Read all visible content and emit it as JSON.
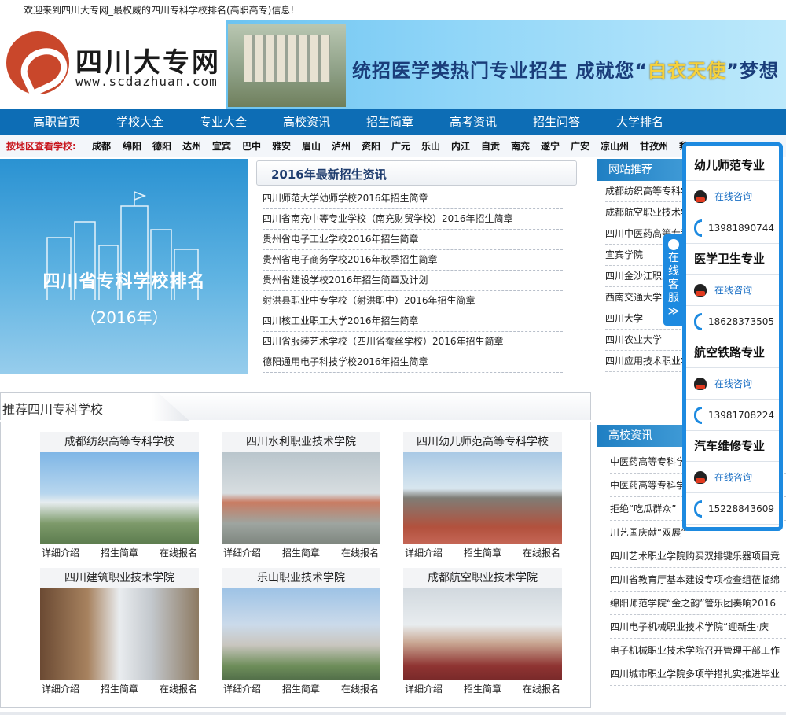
{
  "topbar": {
    "text": "欢迎来到四川大专网_最权威的四川专科学校排名(高职高专)信息!"
  },
  "logo": {
    "cn": "四川大专网",
    "en": "www.scdazhuan.com"
  },
  "banner": {
    "slogan_a": "统招医学类热门专业招生   成就您“",
    "slogan_hl": "白衣天使",
    "slogan_b": "”梦想"
  },
  "nav": [
    "高职首页",
    "学校大全",
    "专业大全",
    "高校资讯",
    "招生简章",
    "高考资讯",
    "招生问答",
    "大学排名"
  ],
  "areas": {
    "label": "按地区查看学校:",
    "items": [
      "成都",
      "绵阳",
      "德阳",
      "达州",
      "宜宾",
      "巴中",
      "雅安",
      "眉山",
      "泸州",
      "资阳",
      "广元",
      "乐山",
      "内江",
      "自贡",
      "南充",
      "遂宁",
      "广安",
      "凉山州",
      "甘孜州",
      "黎"
    ]
  },
  "hero": {
    "title": "四川省专科学校排名",
    "year": "（2016年）"
  },
  "news": {
    "title": "2016年最新招生资讯",
    "items": [
      "四川师范大学幼师学校2016年招生简章",
      "四川省南充中等专业学校（南充财贸学校）2016年招生简章",
      "贵州省电子工业学校2016年招生简章",
      "贵州省电子商务学校2016年秋季招生简章",
      "贵州省建设学校2016年招生简章及计划",
      "射洪县职业中专学校（射洪职中）2016年招生简章",
      "四川核工业职工大学2016年招生简章",
      "四川省服装艺术学校（四川省蚕丝学校）2016年招生简章",
      "德阳通用电子科技学校2016年招生简章"
    ]
  },
  "recommend": {
    "title": "网站推荐",
    "items": [
      "成都纺织高等专科学校",
      "成都航空职业技术学院",
      "四川中医药高等专科学校",
      "宜宾学院",
      "四川金沙江职业学院",
      "西南交通大学",
      "四川大学",
      "四川农业大学",
      "四川应用技术职业学院"
    ]
  },
  "schools": {
    "title": "推荐四川专科学校",
    "actions": [
      "详细介绍",
      "招生简章",
      "在线报名"
    ],
    "items": [
      "成都纺织高等专科学校",
      "四川水利职业技术学院",
      "四川幼儿师范高等专科学校",
      "四川建筑职业技术学院",
      "乐山职业技术学院",
      "成都航空职业技术学院"
    ]
  },
  "gaoxiao": {
    "title": "高校资讯",
    "items": [
      "中医药高等专科学校",
      "中医药高等专科学校",
      "拒绝“吃瓜群众”",
      "川艺国庆献“双展”",
      "四川艺术职业学院购买双排键乐器项目竞",
      "四川省教育厅基本建设专项检查组莅临绵",
      "绵阳师范学院“金之韵”管乐团奏响2016",
      "四川电子机械职业技术学院“迎新生·庆",
      "电子机械职业技术学院召开管理干部工作",
      "四川城市职业学院多项举措扎实推进毕业"
    ]
  },
  "kefu_tab": {
    "text": "在线客服",
    "arrow": "≫"
  },
  "kefu": {
    "groups": [
      {
        "title": "幼儿师范专业",
        "consult": "在线咨询",
        "tel": "13981890744"
      },
      {
        "title": "医学卫生专业",
        "consult": "在线咨询",
        "tel": "18628373505"
      },
      {
        "title": "航空铁路专业",
        "consult": "在线咨询",
        "tel": "13981708224"
      },
      {
        "title": "汽车维修专业",
        "consult": "在线咨询",
        "tel": "15228843609"
      }
    ]
  }
}
